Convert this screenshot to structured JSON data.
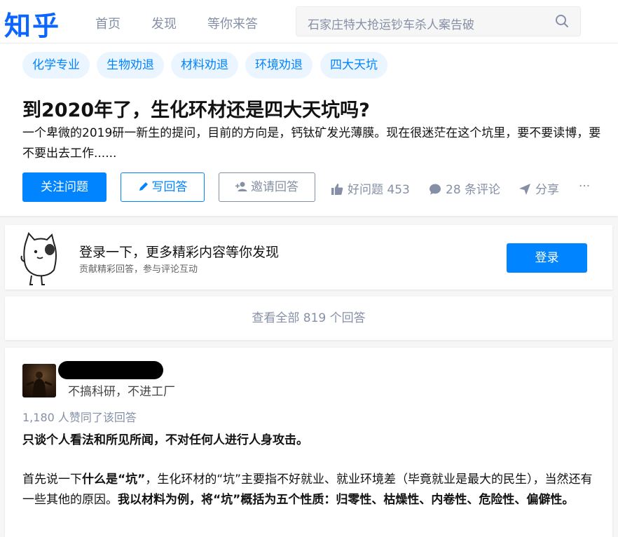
{
  "header": {
    "logo": "知乎",
    "nav": [
      "首页",
      "发现",
      "等你来答"
    ],
    "search_placeholder": "石家庄特大抢运钞车杀人案告破"
  },
  "question": {
    "tags": [
      "化学专业",
      "生物劝退",
      "材料劝退",
      "环境劝退",
      "四大天坑"
    ],
    "title": "到2020年了，生化环材还是四大天坑吗?",
    "description": "一个卑微的2019研一新生的提问，目前的方向是，钙钛矿发光薄膜。现在很迷茫在这个坑里，要不要读博，要不要出去工作......",
    "follow_label": "关注问题",
    "write_label": "写回答",
    "invite_label": "邀请回答",
    "good_question": "好问题 453",
    "comments": "28 条评论",
    "share": "分享",
    "more": "···"
  },
  "login": {
    "title": "登录一下，更多精彩内容等你发现",
    "subtitle": "贡献精彩回答，参与评论互动",
    "button": "登录"
  },
  "view_all": "查看全部 819 个回答",
  "answer": {
    "author_bio": "不搞科研，不进工厂",
    "votes": "1,180 人赞同了该回答",
    "para1": "只谈个人看法和所见所闻，不对任何人进行人身攻击。",
    "para2_a": "首先说一下",
    "para2_b": "什么是“坑”",
    "para2_c": "，生化环材的“坑”主要指不好就业、就业环境差（毕竟就业是最大的民生），当然还有一些其他的原因。",
    "para2_d": "我以材料为例，将“坑”概括为五个性质：归零性、枯燥性、内卷性、危险性、偏僻性。"
  },
  "colors": {
    "brand": "#0084ff",
    "logo": "#0a66ff",
    "muted": "#8590a6",
    "tag_bg": "#ebf5ff"
  }
}
